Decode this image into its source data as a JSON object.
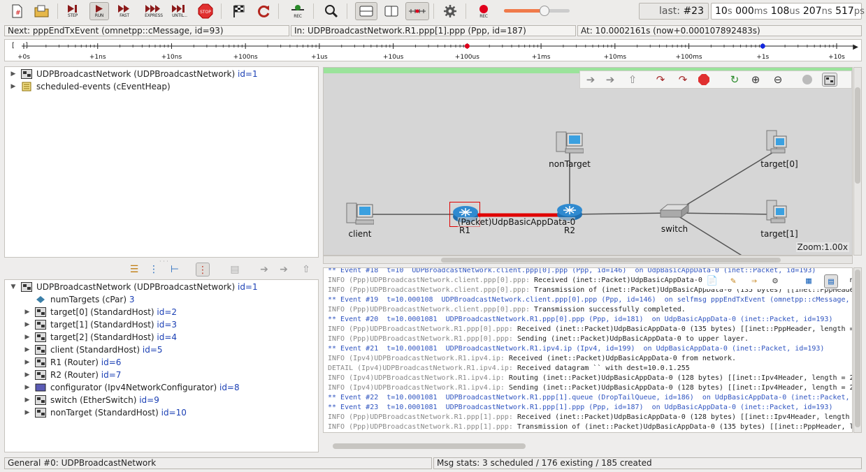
{
  "toolbar": {
    "step": "STEP",
    "run": "RUN",
    "fast": "FAST",
    "express": "EXPRESS",
    "until": "UNTIL...",
    "stop": "STOP",
    "rec": "REC",
    "rec2": "REC",
    "speed": 0.62,
    "last_label": "last: ",
    "last_value": "#23",
    "time": {
      "s": "10",
      "s_u": "s",
      "ms": "000",
      "ms_u": "ms",
      "us": "108",
      "us_u": "us",
      "ns": "207",
      "ns_u": "ns",
      "ps": "517",
      "ps_u": "ps"
    }
  },
  "info": {
    "next": "Next: pppEndTxEvent (omnetpp::cMessage, id=93)",
    "in": "In: UDPBroadcastNetwork.R1.ppp[1].ppp (Ppp, id=187)",
    "at": "At: 10.0002161s (now+0.000107892483s)"
  },
  "timeline": {
    "bracket": "[ ]",
    "ticks": [
      "+0s",
      "+1ns",
      "+10ns",
      "+100ns",
      "+1us",
      "+10us",
      "+100us",
      "+1ms",
      "+10ms",
      "+100ms",
      "+1s",
      "+10s"
    ],
    "markers": [
      {
        "tick": "+100us",
        "color": "#e0001c"
      },
      {
        "tick": "+1s",
        "color": "#1428e0"
      }
    ]
  },
  "obj_tree": [
    {
      "name": "UDPBroadcastNetwork (UDPBroadcastNetwork)",
      "id": "id=1",
      "icon": "module-icon"
    },
    {
      "name": "scheduled-events (cEventHeap)",
      "id": "",
      "icon": "event-heap-icon"
    }
  ],
  "inspector": {
    "root": {
      "name": "UDPBroadcastNetwork (UDPBroadcastNetwork)",
      "id": "id=1"
    },
    "children": [
      {
        "name": "numTargets (cPar)",
        "id": "3",
        "icon": "param-icon",
        "twisty": false
      },
      {
        "name": "target[0] (StandardHost)",
        "id": "id=2",
        "icon": "module-icon",
        "twisty": true
      },
      {
        "name": "target[1] (StandardHost)",
        "id": "id=3",
        "icon": "module-icon",
        "twisty": true
      },
      {
        "name": "target[2] (StandardHost)",
        "id": "id=4",
        "icon": "module-icon",
        "twisty": true
      },
      {
        "name": "client (StandardHost)",
        "id": "id=5",
        "icon": "module-icon",
        "twisty": true
      },
      {
        "name": "R1 (Router)",
        "id": "id=6",
        "icon": "module-icon",
        "twisty": true
      },
      {
        "name": "R2 (Router)",
        "id": "id=7",
        "icon": "module-icon",
        "twisty": true
      },
      {
        "name": "configurator (Ipv4NetworkConfigurator)",
        "id": "id=8",
        "icon": "configurator-icon",
        "twisty": true
      },
      {
        "name": "switch (EtherSwitch)",
        "id": "id=9",
        "icon": "module-icon",
        "twisty": true
      },
      {
        "name": "nonTarget (StandardHost)",
        "id": "id=10",
        "icon": "module-icon",
        "twisty": true
      }
    ]
  },
  "network": {
    "nodes": {
      "client": "client",
      "R1": "R1",
      "R2": "R2",
      "nonTarget": "nonTarget",
      "switch": "switch",
      "target0": "target[0]",
      "target1": "target[1]"
    },
    "packet_label": "(Packet)UdpBasicAppData-0",
    "zoom": "Zoom:1.00x"
  },
  "log": [
    {
      "t": "ev",
      "s": "** Event #18  t=10  UDPBroadcastNetwork.client.ppp[0].ppp (Ppp, id=146)  on UdpBasicAppData-0 (inet::Packet, id=193)"
    },
    {
      "t": "info",
      "p": "INFO (Ppp)UDPBroadcastNetwork.client.ppp[0].ppp: ",
      "s": "Received (inet::Packet)UdpBasicAppData-0 (128 bytes) [[inet::Ipv4Header, len"
    },
    {
      "t": "info",
      "p": "INFO (Ppp)UDPBroadcastNetwork.client.ppp[0].ppp: ",
      "s": "Transmission of (inet::Packet)UdpBasicAppData-0 (135 bytes) [[inet::PppHeade"
    },
    {
      "t": "ev",
      "s": "** Event #19  t=10.000108  UDPBroadcastNetwork.client.ppp[0].ppp (Ppp, id=146)  on selfmsg pppEndTxEvent (omnetpp::cMessage,"
    },
    {
      "t": "info",
      "p": "INFO (Ppp)UDPBroadcastNetwork.client.ppp[0].ppp: ",
      "s": "Transmission successfully completed."
    },
    {
      "t": "ev",
      "s": "** Event #20  t=10.0001081  UDPBroadcastNetwork.R1.ppp[0].ppp (Ppp, id=181)  on UdpBasicAppData-0 (inet::Packet, id=193)"
    },
    {
      "t": "info",
      "p": "INFO (Ppp)UDPBroadcastNetwork.R1.ppp[0].ppp: ",
      "s": "Received (inet::Packet)UdpBasicAppData-0 (135 bytes) [[inet::PppHeader, length ="
    },
    {
      "t": "info",
      "p": "INFO (Ppp)UDPBroadcastNetwork.R1.ppp[0].ppp: ",
      "s": "Sending (inet::Packet)UdpBasicAppData-0 to upper layer."
    },
    {
      "t": "ev",
      "s": "** Event #21  t=10.0001081  UDPBroadcastNetwork.R1.ipv4.ip (Ipv4, id=199)  on UdpBasicAppData-0 (inet::Packet, id=193)"
    },
    {
      "t": "info",
      "p": "INFO (Ipv4)UDPBroadcastNetwork.R1.ipv4.ip: ",
      "s": "Received (inet::Packet)UdpBasicAppData-0 from network."
    },
    {
      "t": "info",
      "p": "DETAIL (Ipv4)UDPBroadcastNetwork.R1.ipv4.ip: ",
      "s": "Received datagram `` with dest=10.0.1.255"
    },
    {
      "t": "info",
      "p": "INFO (Ipv4)UDPBroadcastNetwork.R1.ipv4.ip: ",
      "s": "Routing (inet::Packet)UdpBasicAppData-0 (128 bytes) [[inet::Ipv4Header, length = 2"
    },
    {
      "t": "info",
      "p": "INFO (Ipv4)UDPBroadcastNetwork.R1.ipv4.ip: ",
      "s": "Sending (inet::Packet)UdpBasicAppData-0 (128 bytes) [[inet::Ipv4Header, length = 2"
    },
    {
      "t": "ev",
      "s": "** Event #22  t=10.0001081  UDPBroadcastNetwork.R1.ppp[1].queue (DropTailQueue, id=186)  on UdpBasicAppData-0 (inet::Packet,"
    },
    {
      "t": "ev",
      "s": "** Event #23  t=10.0001081  UDPBroadcastNetwork.R1.ppp[1].ppp (Ppp, id=187)  on UdpBasicAppData-0 (inet::Packet, id=193)"
    },
    {
      "t": "info",
      "p": "INFO (Ppp)UDPBroadcastNetwork.R1.ppp[1].ppp: ",
      "s": "Received (inet::Packet)UdpBasicAppData-0 (128 bytes) [[inet::Ipv4Header, length"
    },
    {
      "t": "info",
      "p": "INFO (Ppp)UDPBroadcastNetwork.R1.ppp[1].ppp: ",
      "s": "Transmission of (inet::Packet)UdpBasicAppData-0 (135 bytes) [[inet::PppHeader, l"
    }
  ],
  "status": {
    "left": "General #0: UDPBroadcastNetwork",
    "right": "Msg stats: 3 scheduled / 176 existing / 185 created"
  }
}
